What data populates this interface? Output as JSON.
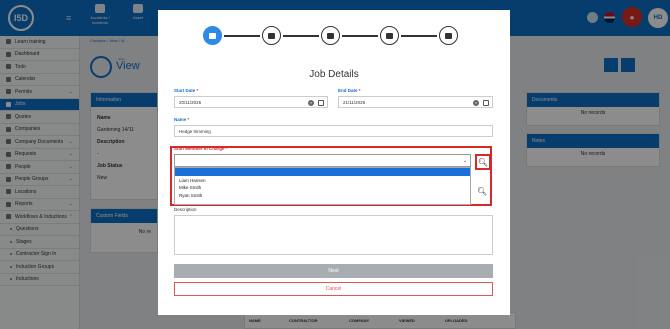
{
  "topbar": {
    "logo": "I5D",
    "tabs": [
      {
        "label": "Accidents / Incidents"
      },
      {
        "label": "Asset"
      }
    ],
    "avatar_initials": "HD"
  },
  "sidebar": {
    "items": [
      {
        "label": "Learn training",
        "icon": "graduation-icon"
      },
      {
        "label": "Dashboard",
        "icon": "dashboard-icon"
      },
      {
        "label": "Todo",
        "icon": "todo-icon"
      },
      {
        "label": "Calendar",
        "icon": "calendar-icon"
      },
      {
        "label": "Permits",
        "icon": "permit-icon"
      },
      {
        "label": "Jobs",
        "icon": "jobs-icon"
      },
      {
        "label": "Quotes",
        "icon": "quote-icon"
      },
      {
        "label": "Companies",
        "icon": "company-icon"
      },
      {
        "label": "Company Documents",
        "icon": "document-icon"
      },
      {
        "label": "Requests",
        "icon": "request-icon"
      },
      {
        "label": "People",
        "icon": "people-icon"
      },
      {
        "label": "People Groups",
        "icon": "group-icon"
      },
      {
        "label": "Locations",
        "icon": "location-icon"
      },
      {
        "label": "Reports",
        "icon": "report-icon"
      },
      {
        "label": "Workflows & Inductions",
        "icon": "workflow-icon"
      },
      {
        "label": "Questions",
        "icon": "dot-icon"
      },
      {
        "label": "Stages",
        "icon": "dot-icon"
      },
      {
        "label": "Contractor Sign In",
        "icon": "dot-icon"
      },
      {
        "label": "Induction Groups",
        "icon": "dot-icon"
      },
      {
        "label": "Inductions",
        "icon": "dot-icon"
      }
    ]
  },
  "background": {
    "crumb": "Contacts / Jobs / Vi...",
    "view_sub": "Jobs",
    "view_title": "View",
    "info_panel": "Information",
    "name_label": "Name",
    "name_value": "Gardening 14/11",
    "desc_label": "Description",
    "desc_value": "-",
    "status_label": "Job Status",
    "status_value": "New",
    "custom_fields": "Custom Fields",
    "no_records_partial": "No re",
    "documents_panel": "Documents",
    "notes_panel": "Notes",
    "no_records": "No records",
    "table_headers": [
      "NAME",
      "CONTRACTOR",
      "COMPANY",
      "VIEWED",
      "UPLOADED"
    ]
  },
  "modal": {
    "title": "Job Details",
    "start_date_label": "Start Date",
    "start_date_value": "20/11/2025",
    "end_date_label": "End Date",
    "end_date_value": "21/11/2025",
    "name_label": "Name",
    "name_value": "Hedge trimming",
    "staff_label": "Staff Member in Charge",
    "staff_options": [
      "",
      "Liam Hansen",
      "Mike Smith",
      "Ryan Smith"
    ],
    "description_label": "Description",
    "next_label": "Next",
    "cancel_label": "Cancel",
    "required_mark": "*"
  },
  "colors": {
    "primary": "#0d6fc7",
    "danger": "#d62a2a",
    "highlight": "#1a6fd8"
  }
}
